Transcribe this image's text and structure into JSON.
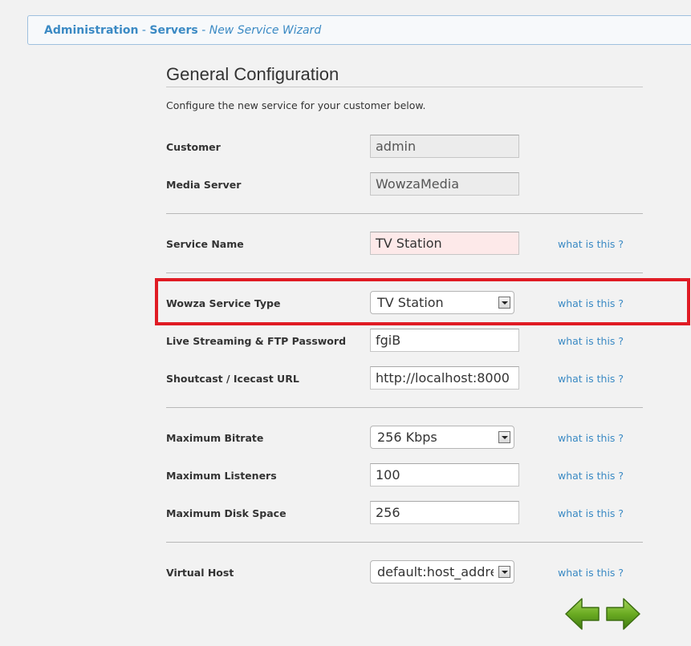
{
  "breadcrumb": {
    "admin": "Administration",
    "sep1": " - ",
    "servers": "Servers",
    "sep2": " - ",
    "current": "New Service Wizard"
  },
  "page": {
    "title": "General Configuration",
    "intro": "Configure the new service for your customer below."
  },
  "form": {
    "customer": {
      "label": "Customer",
      "value": "admin"
    },
    "media_server": {
      "label": "Media Server",
      "value": "WowzaMedia"
    },
    "service_name": {
      "label": "Service Name",
      "value": "TV Station",
      "help": "what is this ?"
    },
    "service_type": {
      "label": "Wowza Service Type",
      "value": "TV Station",
      "help": "what is this ?"
    },
    "password": {
      "label": "Live Streaming & FTP Password",
      "value": "fgiB",
      "help": "what is this ?"
    },
    "shoutcast_url": {
      "label": "Shoutcast / Icecast URL",
      "value": "http://localhost:8000",
      "help": "what is this ?"
    },
    "max_bitrate": {
      "label": "Maximum Bitrate",
      "value": "256 Kbps",
      "help": "what is this ?"
    },
    "max_listeners": {
      "label": "Maximum Listeners",
      "value": "100",
      "help": "what is this ?"
    },
    "max_disk": {
      "label": "Maximum Disk Space",
      "value": "256",
      "help": "what is this ?"
    },
    "virtual_host": {
      "label": "Virtual Host",
      "value": "default:host_address",
      "help": "what is this ?"
    }
  },
  "colors": {
    "link": "#3b8ac4",
    "highlight": "#e01b24",
    "arrow_green": "#5a9a1a",
    "invalid_bg": "#fde9e9"
  },
  "icons": {
    "back": "back-arrow-icon",
    "next": "next-arrow-icon"
  }
}
